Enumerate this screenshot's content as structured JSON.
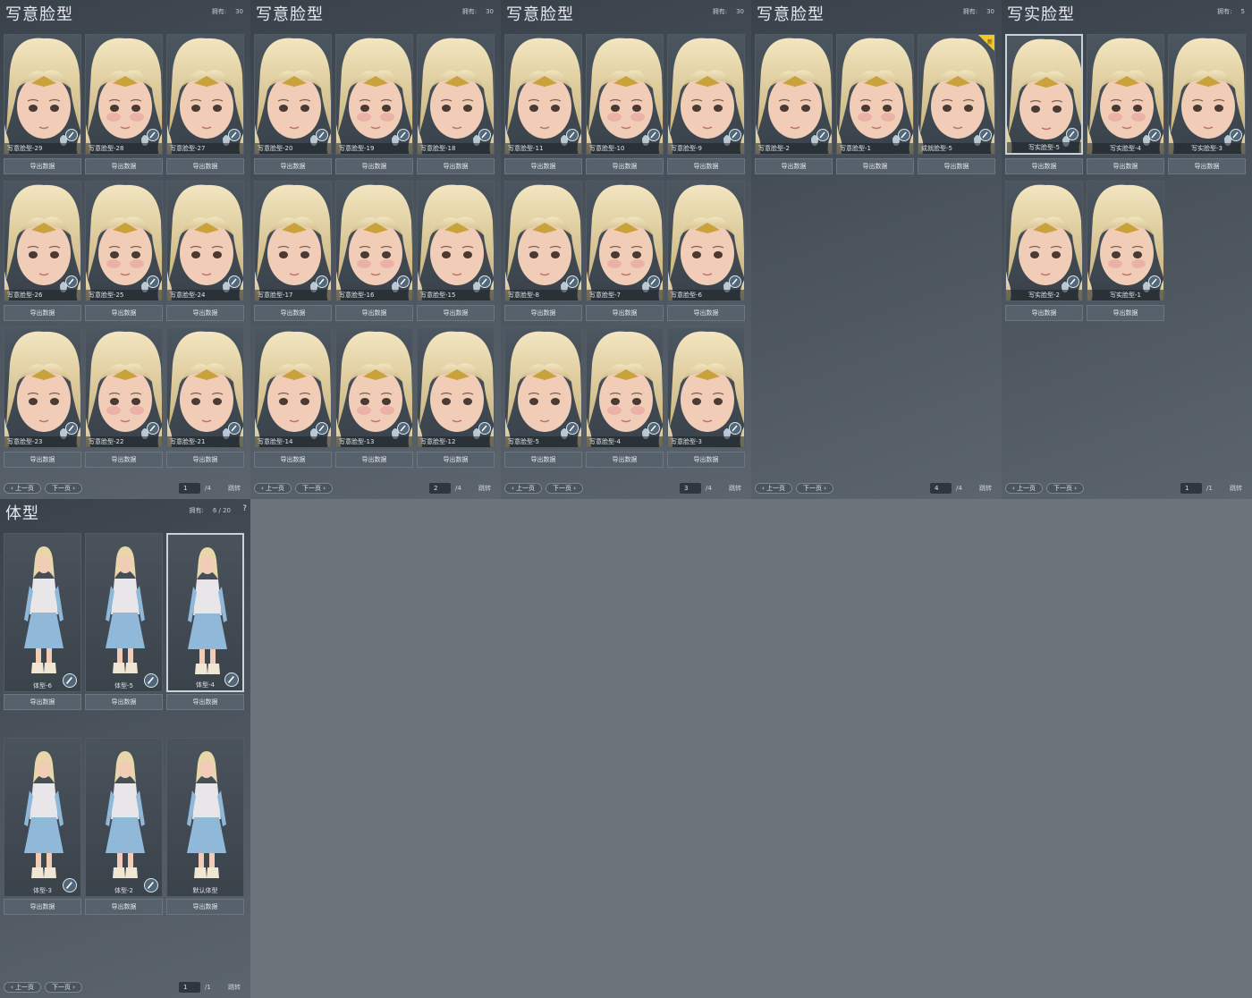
{
  "common": {
    "export_label": "导出数据",
    "prev_label": "上一页",
    "next_label": "下一页",
    "jump_label": "跳转",
    "help_label": "?"
  },
  "panels": [
    {
      "title": "写意脸型",
      "owned_label": "拥有:",
      "owned_value": "30",
      "page": "1",
      "total": "/4",
      "cards": [
        "写意脸型-29",
        "写意脸型-28",
        "写意脸型-27",
        "写意脸型-26",
        "写意脸型-25",
        "写意脸型-24",
        "写意脸型-23",
        "写意脸型-22",
        "写意脸型-21"
      ]
    },
    {
      "title": "写意脸型",
      "owned_label": "拥有:",
      "owned_value": "30",
      "page": "2",
      "total": "/4",
      "cards": [
        "写意脸型-20",
        "写意脸型-19",
        "写意脸型-18",
        "写意脸型-17",
        "写意脸型-16",
        "写意脸型-15",
        "写意脸型-14",
        "写意脸型-13",
        "写意脸型-12"
      ]
    },
    {
      "title": "写意脸型",
      "owned_label": "拥有:",
      "owned_value": "30",
      "page": "3",
      "total": "/4",
      "cards": [
        "写意脸型-11",
        "写意脸型-10",
        "写意脸型-9",
        "写意脸型-8",
        "写意脸型-7",
        "写意脸型-6",
        "写意脸型-5",
        "写意脸型-4",
        "写意脸型-3"
      ]
    },
    {
      "title": "写意脸型",
      "owned_label": "拥有:",
      "owned_value": "30",
      "page": "4",
      "total": "/4",
      "cards": [
        "写意脸型-2",
        "写意脸型-1",
        "成就脸型-5"
      ]
    },
    {
      "title": "写实脸型",
      "owned_label": "拥有:",
      "owned_value": "5",
      "page": "1",
      "total": "/1",
      "cards": [
        "写实脸型-5",
        "写实脸型-4",
        "写实脸型-3",
        "写实脸型-2",
        "写实脸型-1"
      ]
    }
  ],
  "body_panel": {
    "title": "体型",
    "owned_label": "拥有:",
    "owned_value": "6 / 20",
    "page": "1",
    "total": "/1",
    "cards": [
      "体型-6",
      "体型-5",
      "体型-4",
      "体型-3",
      "体型-2",
      "默认体型"
    ]
  },
  "colors": {
    "hair": "#e8d7a8",
    "skin": "#f1cdb8",
    "dress": "#8fb8d9",
    "tiara": "#c9a23c",
    "panel_bg": "#454e57",
    "page_bg": "#6b737b"
  },
  "icons": {
    "brush": "brush-icon",
    "new": "new-tag-icon",
    "prev": "chevron-left-icon",
    "next": "chevron-right-icon"
  }
}
